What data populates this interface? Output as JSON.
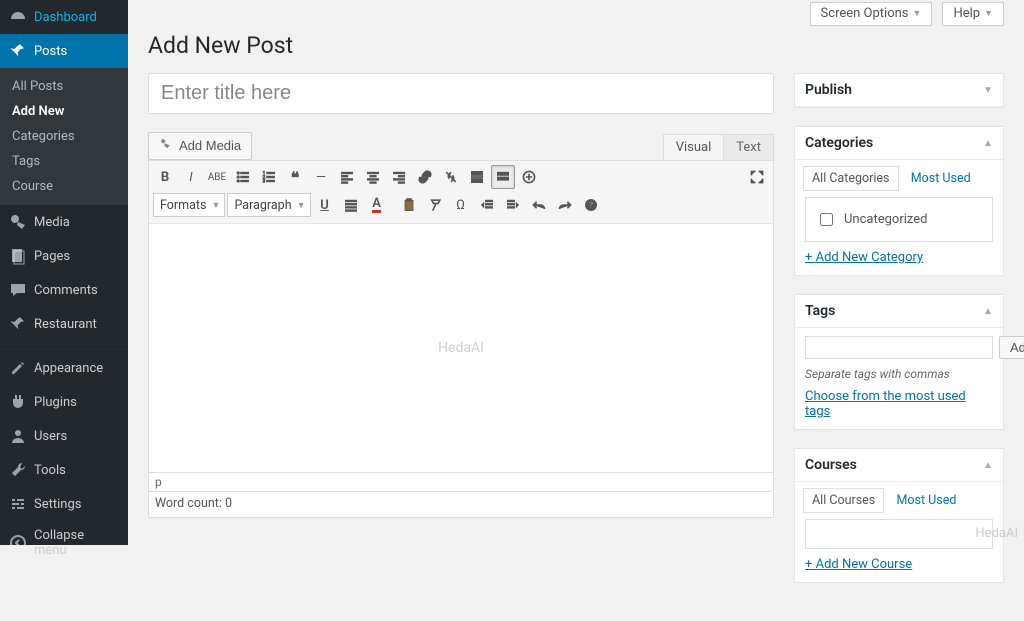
{
  "sidebar": {
    "dashboard": "Dashboard",
    "posts": "Posts",
    "posts_sub": [
      "All Posts",
      "Add New",
      "Categories",
      "Tags",
      "Course"
    ],
    "media": "Media",
    "pages": "Pages",
    "comments": "Comments",
    "restaurant": "Restaurant",
    "appearance": "Appearance",
    "plugins": "Plugins",
    "users": "Users",
    "tools": "Tools",
    "settings": "Settings",
    "collapse": "Collapse menu"
  },
  "top": {
    "screen_options": "Screen Options",
    "help": "Help"
  },
  "page_title": "Add New Post",
  "title_placeholder": "Enter title here",
  "editor": {
    "add_media": "Add Media",
    "tab_visual": "Visual",
    "tab_text": "Text",
    "formats": "Formats",
    "paragraph": "Paragraph",
    "watermark": "HedaAI",
    "path": "p",
    "wordcount": "Word count: 0"
  },
  "panels": {
    "publish": {
      "title": "Publish"
    },
    "categories": {
      "title": "Categories",
      "tab_all": "All Categories",
      "tab_most": "Most Used",
      "item": "Uncategorized",
      "add": "+ Add New Category"
    },
    "tags": {
      "title": "Tags",
      "add_btn": "Add",
      "hint": "Separate tags with commas",
      "choose": "Choose from the most used tags"
    },
    "courses": {
      "title": "Courses",
      "tab_all": "All Courses",
      "tab_most": "Most Used",
      "add": "+ Add New Course"
    }
  },
  "footer_mark": "HedaAI"
}
